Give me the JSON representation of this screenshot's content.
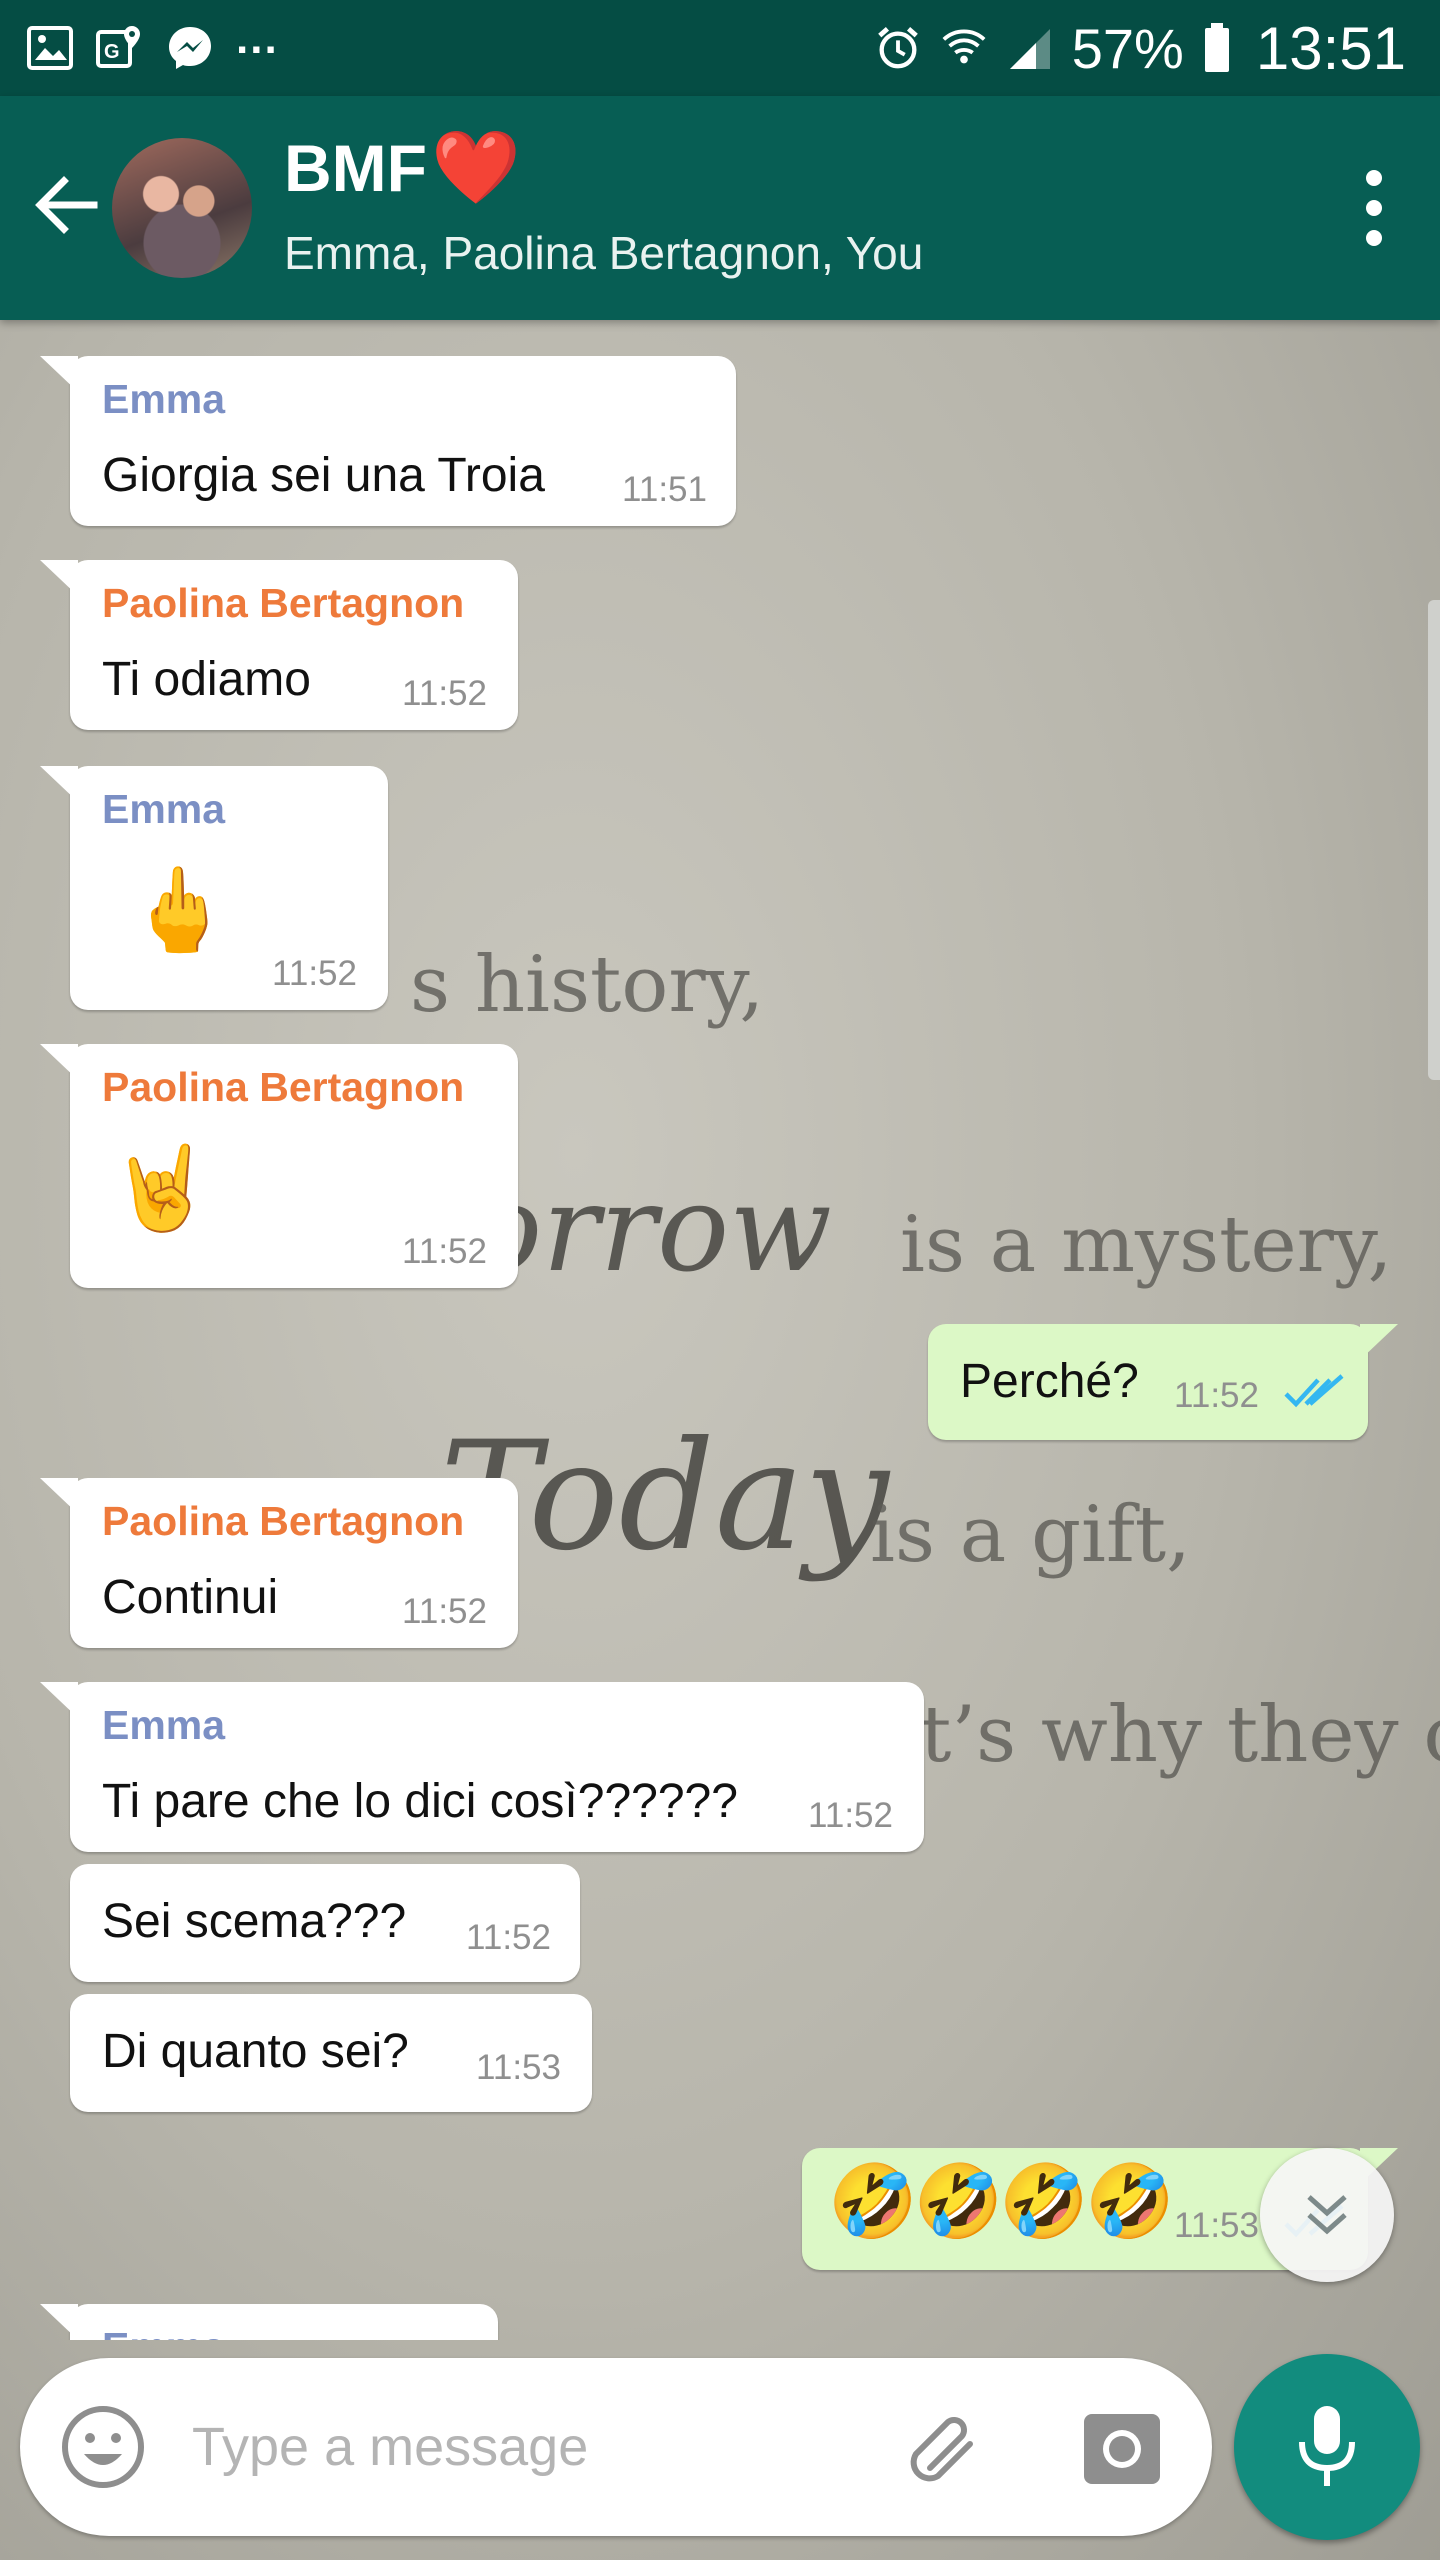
{
  "status_bar": {
    "notification_icons": [
      "gallery-icon",
      "maps-icon",
      "messenger-icon"
    ],
    "more": "...",
    "battery_pct": "57%",
    "time": "13:51"
  },
  "header": {
    "title": "BMF",
    "title_emoji": "❤️",
    "subtitle": "Emma, Paolina Bertagnon, You"
  },
  "wallpaper": {
    "line1": "s history,",
    "line2_script": "orrow",
    "line2": "is a mystery,",
    "line3_script": "Today",
    "line3": "is a gift,",
    "line4": "t’s why they c"
  },
  "messages": [
    {
      "sender": "Emma",
      "text": "Giorgia sei una Troia",
      "time": "11:51"
    },
    {
      "sender": "Paolina Bertagnon",
      "text": "Ti odiamo",
      "time": "11:52"
    },
    {
      "sender": "Emma",
      "emoji": "🖕",
      "time": "11:52"
    },
    {
      "sender": "Paolina Bertagnon",
      "emoji": "🤘",
      "time": "11:52"
    },
    {
      "text": "Perché?",
      "time": "11:52",
      "outgoing": true,
      "status": "read"
    },
    {
      "sender": "Paolina Bertagnon",
      "text": "Continui",
      "time": "11:52"
    },
    {
      "sender": "Emma",
      "text": "Ti pare che lo dici così??????",
      "time": "11:52"
    },
    {
      "text": "Sei scema???",
      "time": "11:52"
    },
    {
      "text": "Di quanto sei?",
      "time": "11:53"
    },
    {
      "emoji": "🤣🤣🤣🤣",
      "time": "11:53",
      "outgoing": true,
      "status": "read"
    },
    {
      "sender": "Emma"
    }
  ],
  "composer": {
    "placeholder": "Type a message"
  },
  "colors": {
    "header": "#075e54",
    "status_bar": "#054d44",
    "outgoing_bubble": "#dcf8c6",
    "incoming_bubble": "#ffffff",
    "emma_name": "#7b8fc4",
    "paolina_name": "#ee7a3b",
    "read_ticks": "#34b7f1",
    "mic_button": "#128c7e"
  }
}
